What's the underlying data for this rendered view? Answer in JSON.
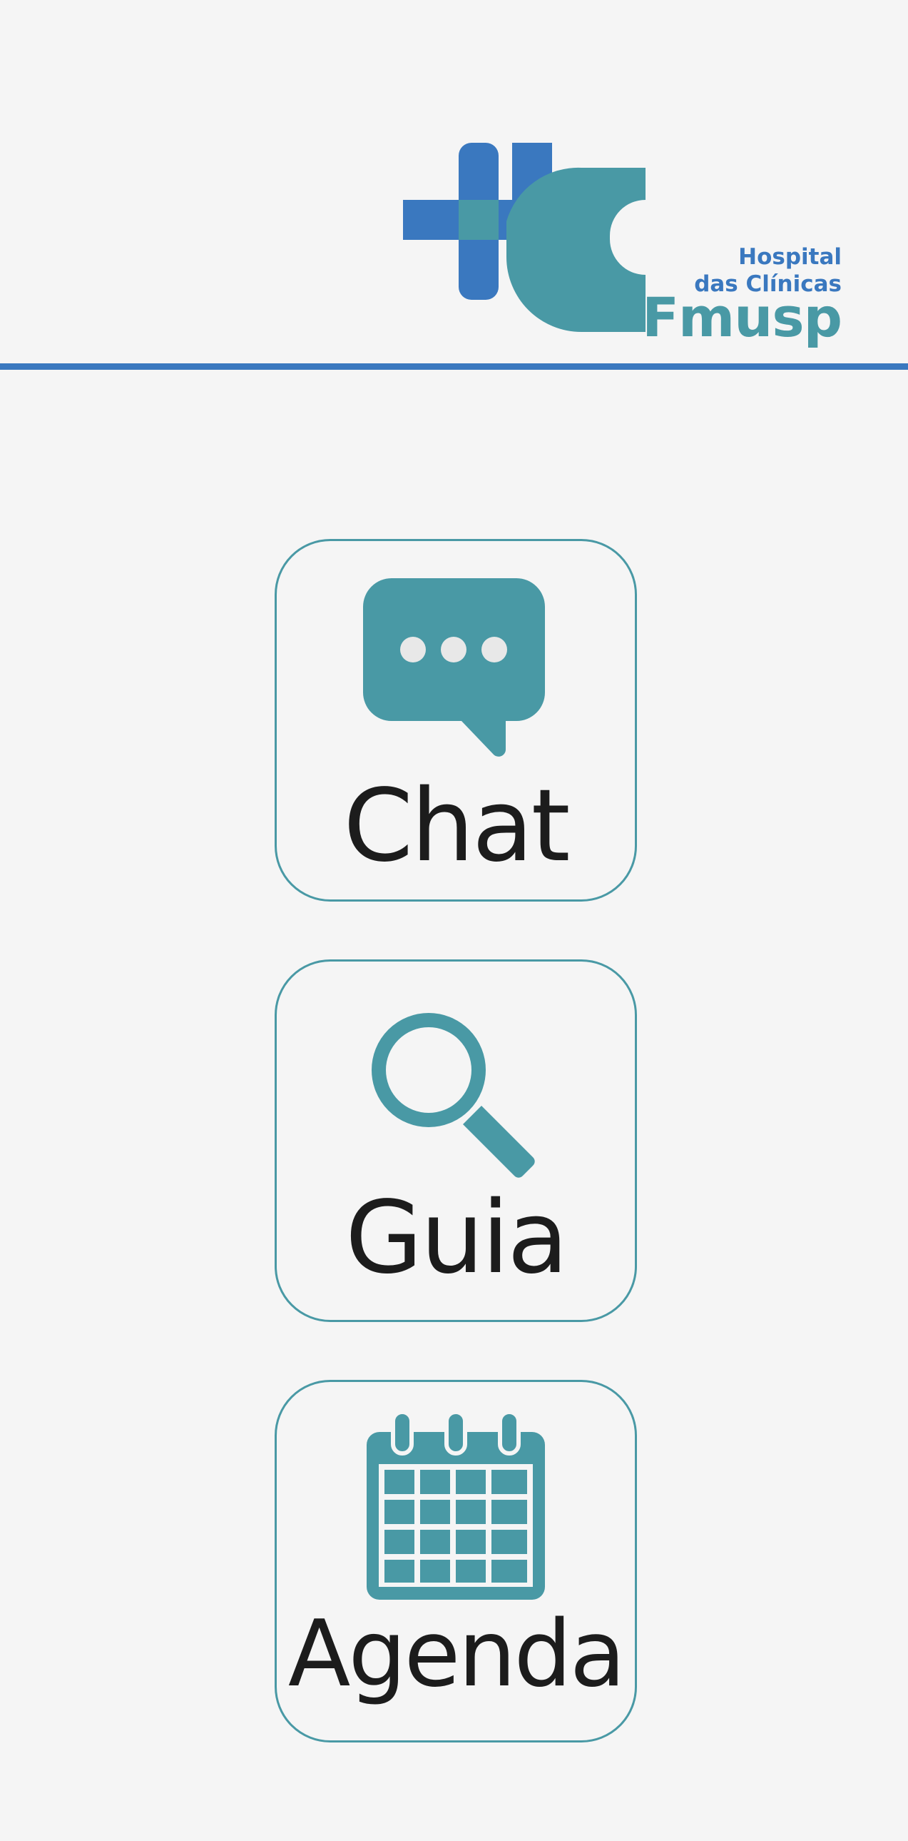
{
  "header": {
    "logo": {
      "line1": "Hospital",
      "line2": "das Clínicas",
      "line3": "Fmusp"
    }
  },
  "menu": {
    "items": [
      {
        "id": "chat",
        "label": "Chat",
        "icon": "chat-bubble-icon"
      },
      {
        "id": "guia",
        "label": "Guia",
        "icon": "search-icon"
      },
      {
        "id": "agenda",
        "label": "Agenda",
        "icon": "calendar-icon"
      }
    ]
  },
  "colors": {
    "background": "#f5f5f5",
    "brand_blue": "#3a78bf",
    "brand_teal": "#4999a5",
    "text": "#1c1c1c"
  }
}
